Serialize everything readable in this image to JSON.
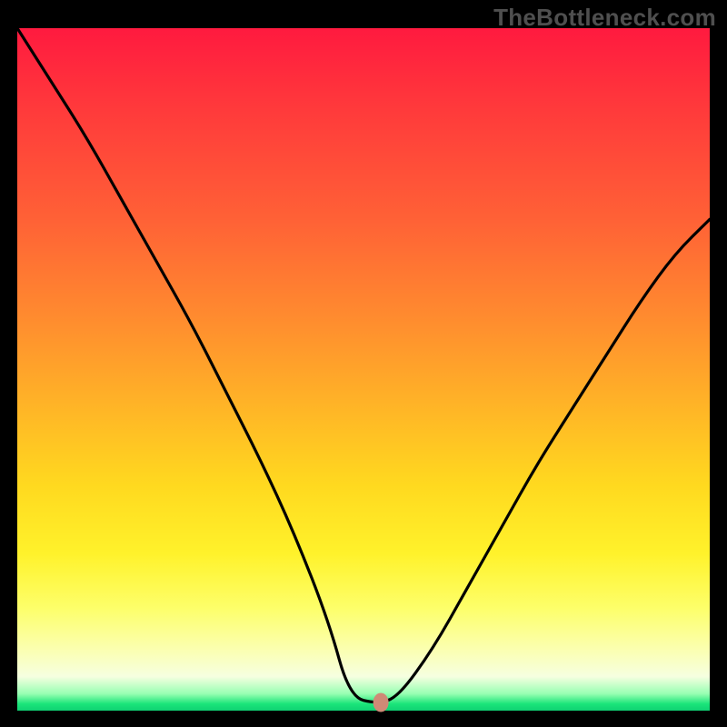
{
  "watermark": "TheBottleneck.com",
  "chart_data": {
    "type": "line",
    "title": "",
    "xlabel": "",
    "ylabel": "",
    "x_range_fraction": [
      0,
      1
    ],
    "y_range_fraction": [
      0,
      1
    ],
    "note": "Axes unlabeled; values are fractional positions within the plot area (0=left/bottom, 1=right/top). y represents the height of the V-shaped bottleneck curve; background gradient encodes red (high y) → green (low y).",
    "series": [
      {
        "name": "bottleneck-curve",
        "x": [
          0.0,
          0.05,
          0.1,
          0.15,
          0.2,
          0.25,
          0.3,
          0.35,
          0.4,
          0.45,
          0.48,
          0.52,
          0.55,
          0.6,
          0.65,
          0.7,
          0.75,
          0.8,
          0.85,
          0.9,
          0.95,
          1.0
        ],
        "y": [
          1.0,
          0.92,
          0.84,
          0.75,
          0.66,
          0.57,
          0.47,
          0.37,
          0.26,
          0.13,
          0.02,
          0.01,
          0.02,
          0.09,
          0.18,
          0.27,
          0.36,
          0.44,
          0.52,
          0.6,
          0.67,
          0.72
        ]
      }
    ],
    "marker": {
      "x": 0.525,
      "y": 0.012,
      "name": "optimal-point"
    },
    "background_gradient": {
      "orientation": "vertical",
      "stops": [
        {
          "pos": 0.0,
          "color": "#ff1a3f"
        },
        {
          "pos": 0.28,
          "color": "#ff6136"
        },
        {
          "pos": 0.55,
          "color": "#ffb327"
        },
        {
          "pos": 0.77,
          "color": "#fff22b"
        },
        {
          "pos": 0.95,
          "color": "#f6ffe0"
        },
        {
          "pos": 1.0,
          "color": "#0fd173"
        }
      ]
    }
  }
}
